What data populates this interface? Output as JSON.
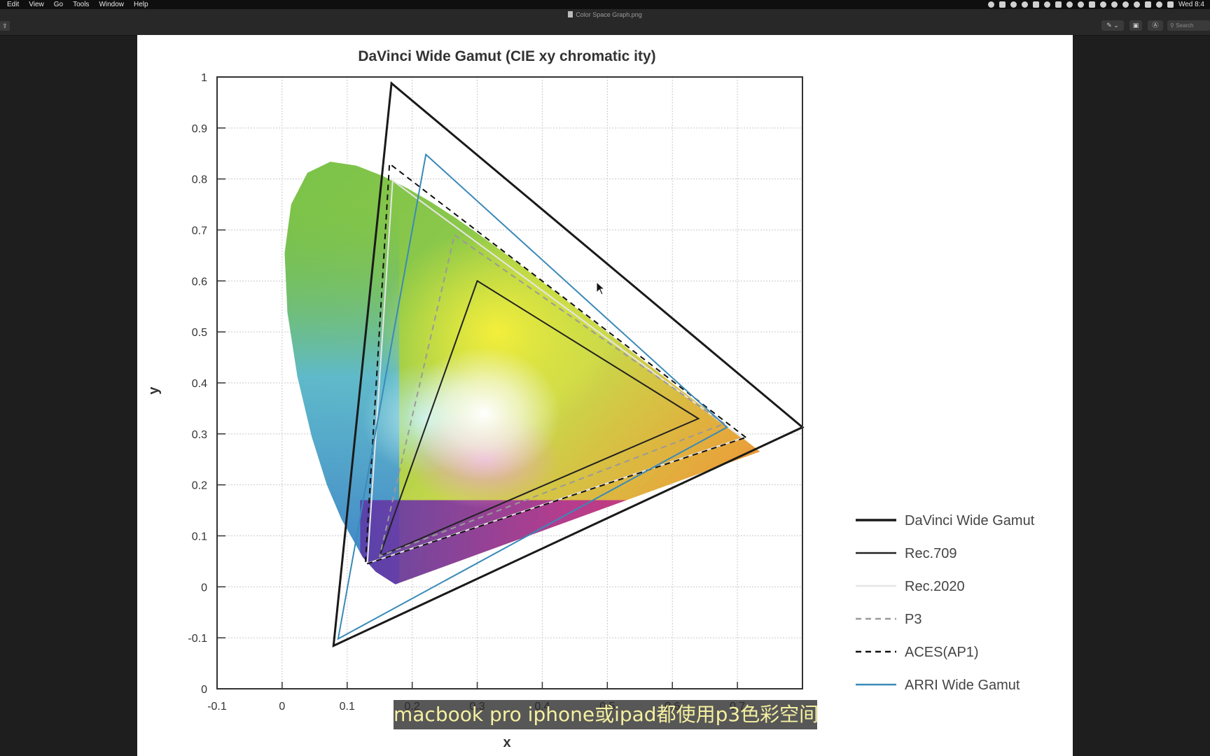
{
  "menubar": {
    "items": [
      "Edit",
      "View",
      "Go",
      "Tools",
      "Window",
      "Help"
    ],
    "clock": "Wed 8:4"
  },
  "window": {
    "title": "Color Space Graph.png",
    "search_placeholder": "Search"
  },
  "subtitle": "macbook pro iphone或ipad都使用p3色彩空间",
  "colors": {
    "davinci": "#1a1a1a",
    "rec709": "#222222",
    "rec2020": "#e6e6e6",
    "p3": "#9a9a9a",
    "aces": "#111111",
    "arri": "#3a8ab8"
  },
  "chart_data": {
    "type": "line",
    "title": "DaVinci Wide Gamut (CIE xy chromatic ity)",
    "xlabel": "x",
    "ylabel": "y",
    "xlim": [
      -0.1,
      0.8
    ],
    "ylim": [
      -0.2,
      1.0
    ],
    "x_ticks": [
      "-0.1",
      "0",
      "0.1",
      "0.2",
      "0.3",
      "0.4",
      "0.5",
      "0.6",
      "0.7"
    ],
    "y_ticks": [
      "1",
      "0.9",
      "0.8",
      "0.7",
      "0.6",
      "0.5",
      "0.4",
      "0.3",
      "0.2",
      "0.1",
      "0",
      "-0.1",
      "0"
    ],
    "grid": true,
    "legend_position": "bottom-right",
    "series": [
      {
        "name": "DaVinci Wide Gamut",
        "style": "solid-thick",
        "points": [
          [
            0.8,
            0.313
          ],
          [
            0.1682,
            0.9877
          ],
          [
            0.079,
            -0.1155
          ]
        ]
      },
      {
        "name": "Rec.709",
        "style": "solid",
        "points": [
          [
            0.64,
            0.33
          ],
          [
            0.3,
            0.6
          ],
          [
            0.15,
            0.06
          ]
        ]
      },
      {
        "name": "Rec.2020",
        "style": "solid-light",
        "points": [
          [
            0.708,
            0.292
          ],
          [
            0.17,
            0.797
          ],
          [
            0.131,
            0.046
          ]
        ]
      },
      {
        "name": "P3",
        "style": "dashed-light",
        "points": [
          [
            0.68,
            0.32
          ],
          [
            0.265,
            0.69
          ],
          [
            0.15,
            0.06
          ]
        ]
      },
      {
        "name": "ACES(AP1)",
        "style": "dashed",
        "points": [
          [
            0.713,
            0.293
          ],
          [
            0.165,
            0.83
          ],
          [
            0.128,
            0.044
          ]
        ]
      },
      {
        "name": "ARRI Wide Gamut",
        "style": "solid-blue",
        "points": [
          [
            0.684,
            0.313
          ],
          [
            0.221,
            0.848
          ],
          [
            0.0861,
            -0.102
          ]
        ]
      }
    ]
  }
}
